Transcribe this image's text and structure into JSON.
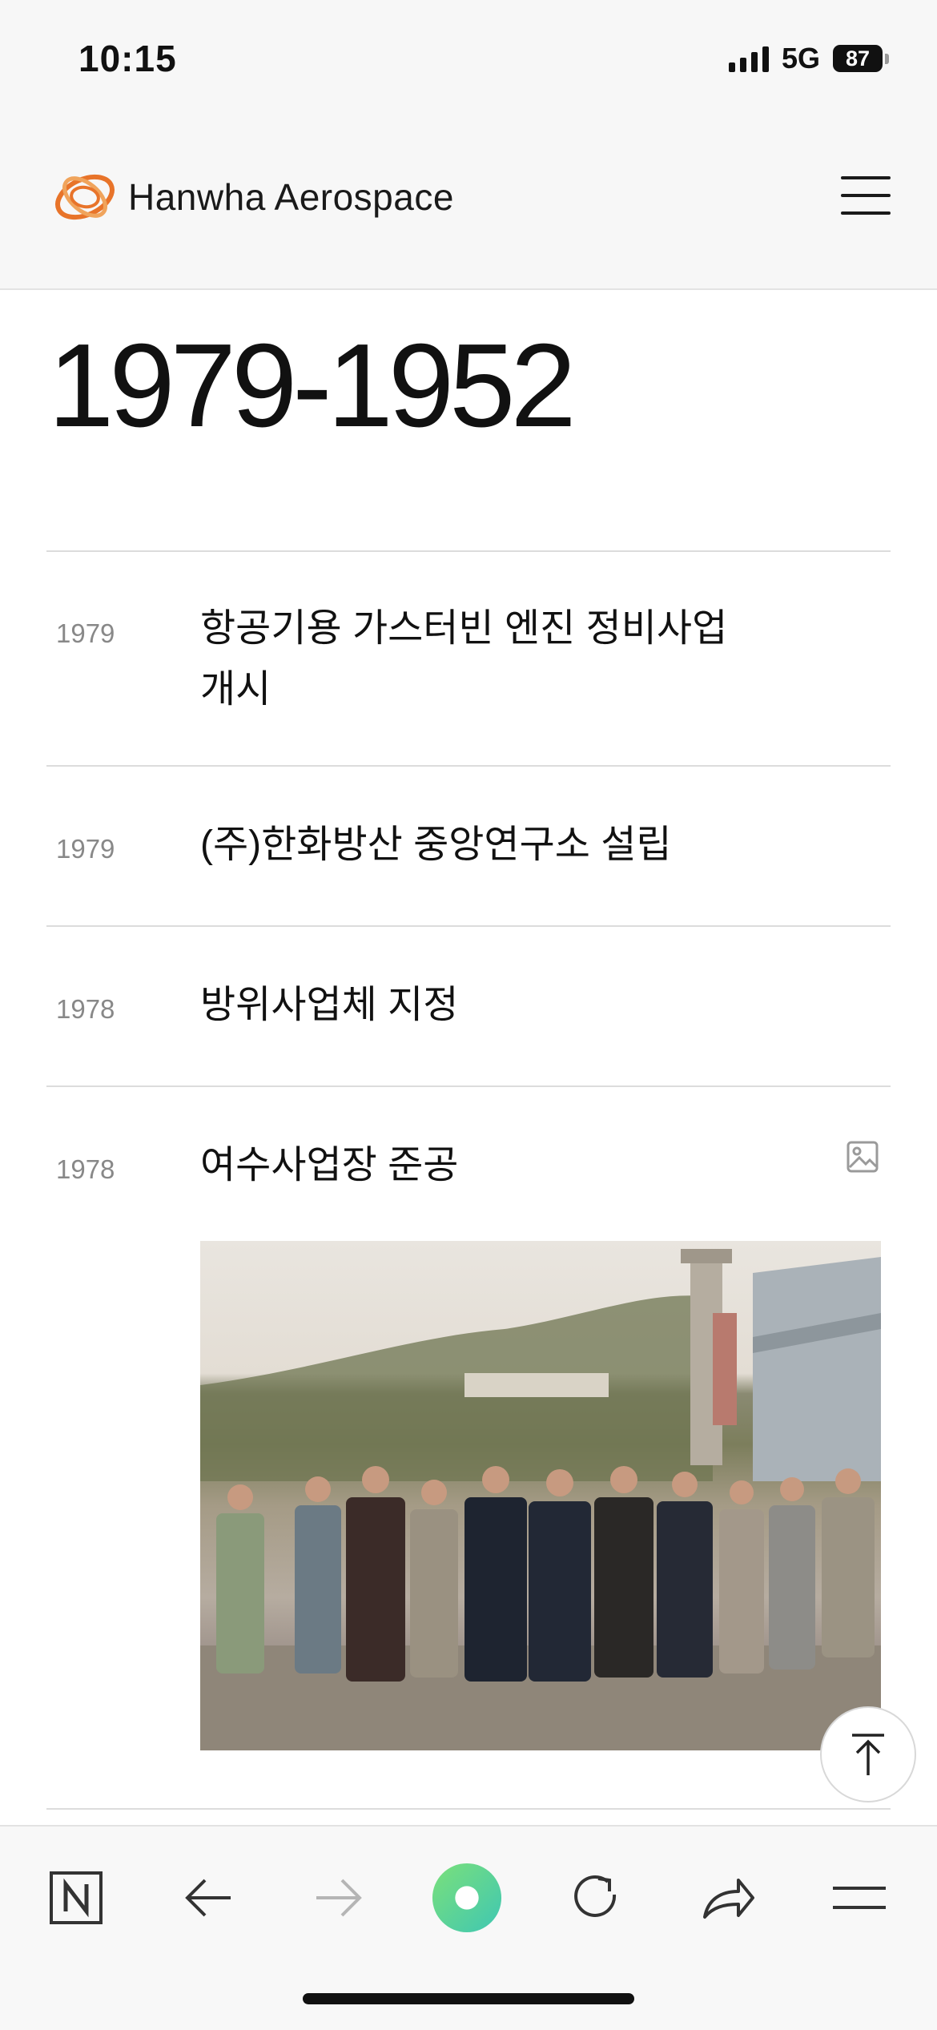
{
  "status_bar": {
    "time": "10:15",
    "network": "5G",
    "battery": "87"
  },
  "header": {
    "brand": "Hanwha Aerospace",
    "menu_icon": "hamburger-menu-icon"
  },
  "page": {
    "title": "1979-1952"
  },
  "timeline": [
    {
      "year": "1979",
      "title": "항공기용 가스터빈 엔진 정비사업 개시"
    },
    {
      "year": "1979",
      "title": "(주)한화방산 중앙연구소 설립"
    },
    {
      "year": "1978",
      "title": "방위사업체 지정"
    },
    {
      "year": "1978",
      "title": "여수사업장 준공",
      "has_image": true
    }
  ],
  "toolbar": {
    "items": [
      "naver-home-icon",
      "back-arrow-icon",
      "forward-arrow-icon",
      "green-dot-icon",
      "reload-icon",
      "share-icon",
      "menu-icon"
    ]
  },
  "colors": {
    "brand_orange": "#e8742a",
    "accent_green": "#4fd08f"
  }
}
